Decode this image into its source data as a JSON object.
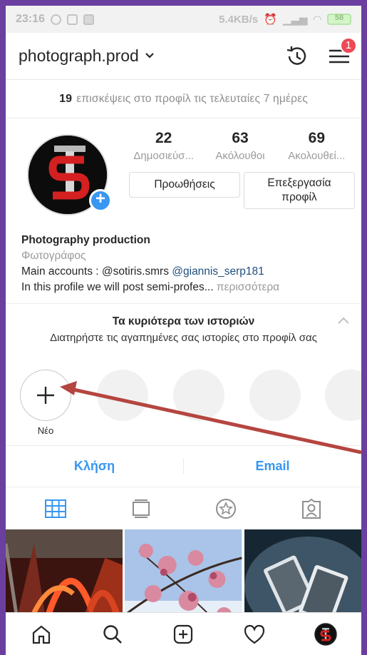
{
  "status_bar": {
    "time": "23:16",
    "net_speed": "5.4KB/s",
    "battery": "58"
  },
  "header": {
    "username": "photograph.prod",
    "notification_count": "1",
    "icons": [
      "history-icon",
      "menu-icon"
    ]
  },
  "visits": {
    "count": "19",
    "text": "επισκέψεις στο προφίλ τις τελευταίες 7 ημέρες"
  },
  "stats": [
    {
      "num": "22",
      "label": "Δημοσιεύσ..."
    },
    {
      "num": "63",
      "label": "Ακόλουθοι"
    },
    {
      "num": "69",
      "label": "Ακολουθεί..."
    }
  ],
  "buttons": {
    "promotions": "Προωθήσεις",
    "edit_line1": "Επεξεργασία",
    "edit_line2": "προφίλ"
  },
  "bio": {
    "name": "Photography production",
    "category": "Φωτογράφος",
    "line1_prefix": "Main accounts : @sotiris.smrs ",
    "line1_mention": "@giannis_serp181",
    "line2": "In this profile we will post semi-profes...",
    "more": " περισσότερα"
  },
  "highlights": {
    "title": "Τα κυριότερα των ιστοριών",
    "desc": "Διατηρήστε τις αγαπημένες σας ιστορίες στο προφίλ σας",
    "new_label": "Νέο"
  },
  "actions": {
    "call": "Κλήση",
    "email": "Email"
  },
  "colors": {
    "accent": "#3897f0",
    "badge": "#ed4956",
    "arrow": "#b5453f"
  }
}
